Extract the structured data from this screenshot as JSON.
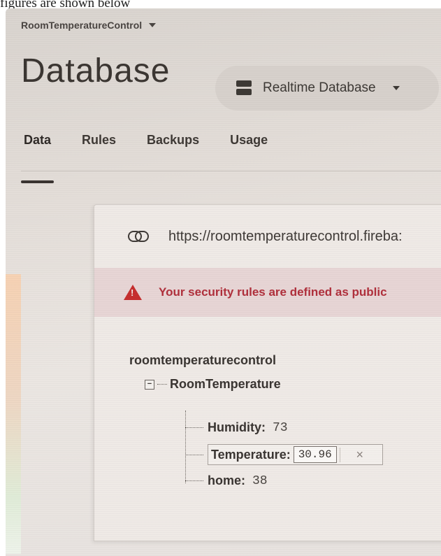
{
  "caption": "figures are shown below",
  "header": {
    "project_name": "RoomTemperatureControl",
    "page_title": "Database",
    "db_selector": "Realtime Database"
  },
  "tabs": [
    {
      "label": "Data",
      "active": true
    },
    {
      "label": "Rules",
      "active": false
    },
    {
      "label": "Backups",
      "active": false
    },
    {
      "label": "Usage",
      "active": false
    }
  ],
  "card": {
    "url": "https://roomtemperaturecontrol.fireba:",
    "warning": "Your security rules are defined as public"
  },
  "tree": {
    "root": "roomtemperaturecontrol",
    "node": "RoomTemperature",
    "collapse_symbol": "−",
    "children": [
      {
        "key": "Humidity:",
        "value": "73"
      },
      {
        "key": "Temperature:",
        "value": "30.96"
      },
      {
        "key": "home:",
        "value": "38"
      }
    ],
    "clear_symbol": "×"
  },
  "colors": {
    "warning_text": "#b0303c",
    "warning_bg": "#e7d5d5",
    "warning_icon": "#c62f2f"
  }
}
